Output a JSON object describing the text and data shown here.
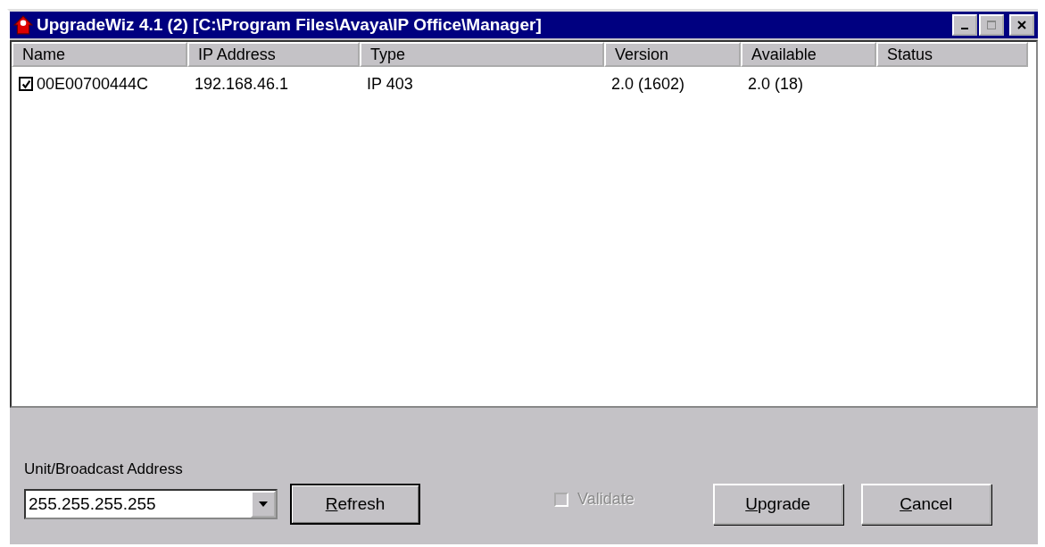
{
  "window": {
    "title": "UpgradeWiz 4.1 (2) [C:\\Program Files\\Avaya\\IP Office\\Manager]"
  },
  "table": {
    "columns": [
      "Name",
      "IP Address",
      "Type",
      "Version",
      "Available",
      "Status"
    ],
    "rows": [
      {
        "checked": true,
        "cells": [
          "00E00700444C",
          "192.168.46.1",
          "IP 403",
          "2.0 (1602)",
          "2.0 (18)",
          ""
        ]
      }
    ]
  },
  "address": {
    "label": "Unit/Broadcast Address",
    "value": "255.255.255.255"
  },
  "refresh_button": {
    "key": "R",
    "rest": "efresh"
  },
  "validate": {
    "label": "Validate",
    "checked": false,
    "disabled": true
  },
  "buttons": [
    {
      "key": "U",
      "rest": "pgrade"
    },
    {
      "key": "C",
      "rest": "ancel"
    }
  ]
}
